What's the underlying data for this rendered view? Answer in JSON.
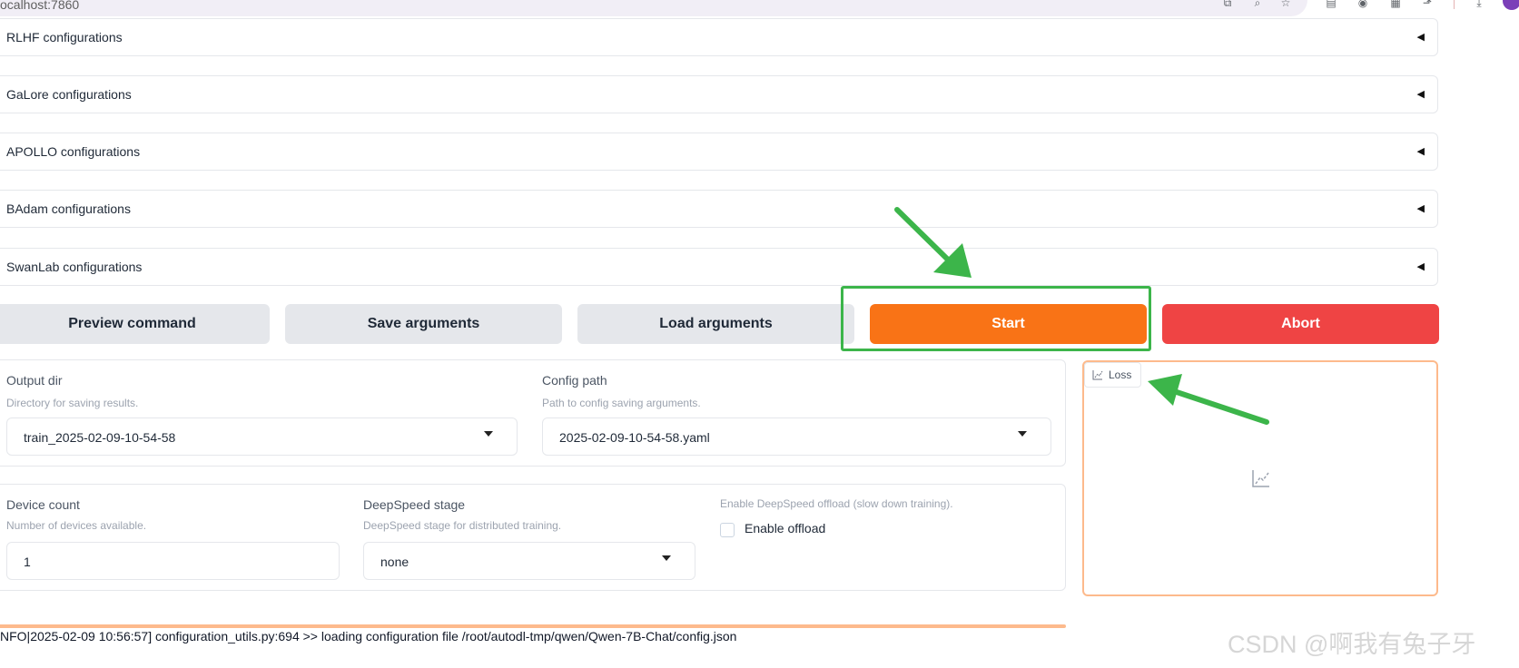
{
  "browser": {
    "url": "ocalhost:7860"
  },
  "accordions": [
    {
      "label": "RLHF configurations"
    },
    {
      "label": "GaLore configurations"
    },
    {
      "label": "APOLLO configurations"
    },
    {
      "label": "BAdam configurations"
    },
    {
      "label": "SwanLab configurations"
    }
  ],
  "actions": {
    "preview": "Preview command",
    "save": "Save arguments",
    "load": "Load arguments",
    "start": "Start",
    "abort": "Abort"
  },
  "output": {
    "output_dir_label": "Output dir",
    "output_dir_hint": "Directory for saving results.",
    "output_dir_value": "train_2025-02-09-10-54-58",
    "config_path_label": "Config path",
    "config_path_hint": "Path to config saving arguments.",
    "config_path_value": "2025-02-09-10-54-58.yaml"
  },
  "device": {
    "device_count_label": "Device count",
    "device_count_hint": "Number of devices available.",
    "device_count_value": "1",
    "deepspeed_label": "DeepSpeed stage",
    "deepspeed_hint": "DeepSpeed stage for distributed training.",
    "deepspeed_value": "none",
    "offload_hint": "Enable DeepSpeed offload (slow down training).",
    "offload_label": "Enable offload",
    "offload_checked": false
  },
  "plot": {
    "tab_label": "Loss"
  },
  "log": {
    "line": "NFO|2025-02-09 10:56:57] configuration_utils.py:694 >> loading configuration file /root/autodl-tmp/qwen/Qwen-7B-Chat/config.json"
  },
  "watermark": "CSDN @啊我有兔子牙",
  "colors": {
    "start": "#f97316",
    "abort": "#ef4444",
    "highlight": "#3cb54a",
    "plot_border": "#fdba8c"
  }
}
